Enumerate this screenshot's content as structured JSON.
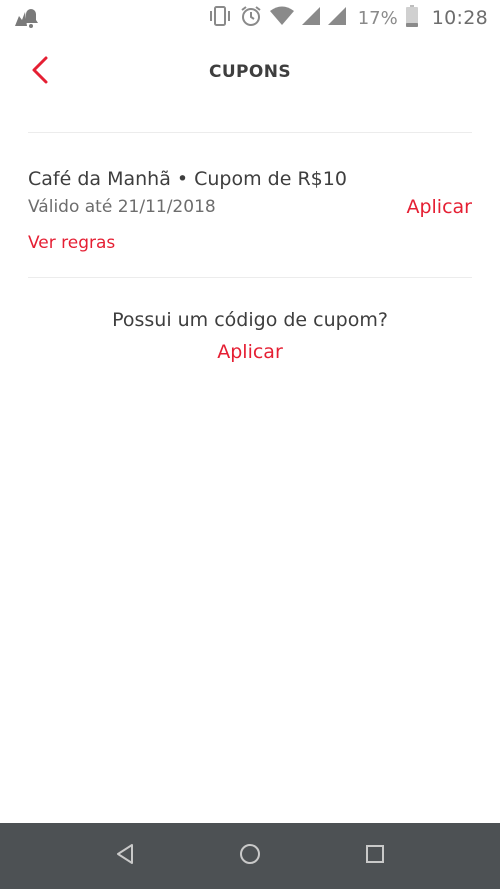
{
  "status_bar": {
    "battery_percent": "17%",
    "time": "10:28",
    "icons": [
      "notification-icon",
      "vibrate-icon",
      "alarm-icon",
      "wifi-icon",
      "signal-icon",
      "signal-icon",
      "battery-icon"
    ]
  },
  "header": {
    "title": "CUPONS",
    "back_icon": "chevron-left-icon"
  },
  "coupon": {
    "title": "Café da Manhã • Cupom de R$10",
    "validity": "Válido até 21/11/2018",
    "apply_label": "Aplicar",
    "rules_label": "Ver regras"
  },
  "code_section": {
    "question": "Possui um código de cupom?",
    "apply_label": "Aplicar"
  },
  "nav_bar": {
    "icons": [
      "back-triangle-icon",
      "home-circle-icon",
      "recents-square-icon"
    ]
  },
  "colors": {
    "accent": "#e51f33",
    "text_primary": "#3e3e3e",
    "text_secondary": "#6d6d6d",
    "nav_bar": "#4d5154"
  }
}
